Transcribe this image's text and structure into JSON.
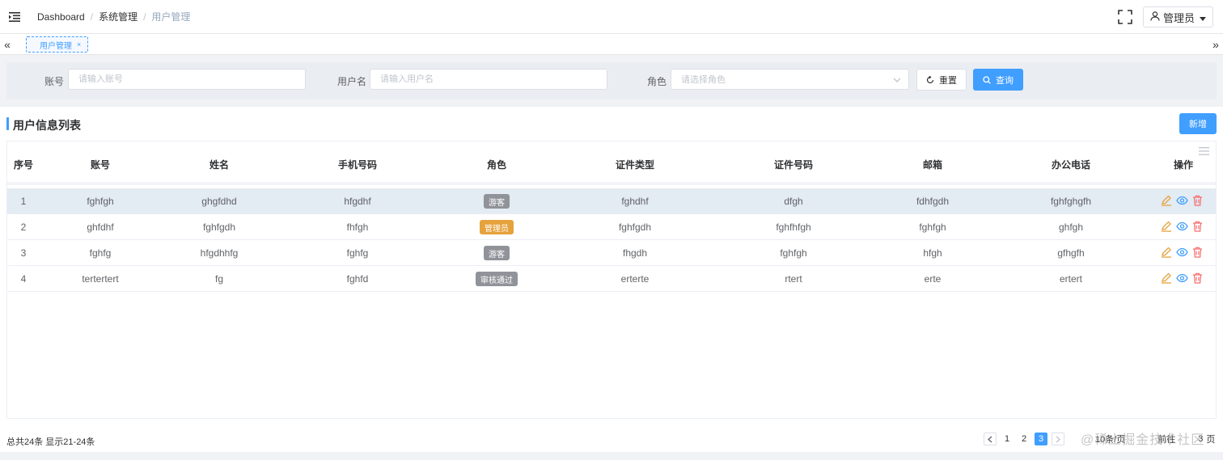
{
  "header": {
    "breadcrumbs": [
      "Dashboard",
      "系统管理",
      "用户管理"
    ],
    "user_name": "管理员"
  },
  "tags": [
    {
      "label": "用户管理",
      "close": "×"
    }
  ],
  "search": {
    "account_label": "账号",
    "account_placeholder": "请输入账号",
    "username_label": "用户名",
    "username_placeholder": "请输入用户名",
    "role_label": "角色",
    "role_placeholder": "请选择角色",
    "reset_label": "重置",
    "query_label": "查询"
  },
  "section": {
    "title": "用户信息列表",
    "add_label": "新增"
  },
  "table": {
    "columns": [
      "序号",
      "账号",
      "姓名",
      "手机号码",
      "角色",
      "证件类型",
      "证件号码",
      "邮箱",
      "办公电话",
      "操作"
    ],
    "rows": [
      {
        "index": "1",
        "account": "fghfgh",
        "name": "ghgfdhd",
        "phone": "hfgdhf",
        "role": "游客",
        "role_color": "#909399",
        "id_type": "fghdhf",
        "id_number": "dfgh",
        "email": "fdhfgdh",
        "office_phone": "fghfghgfh"
      },
      {
        "index": "2",
        "account": "ghfdhf",
        "name": "fghfgdh",
        "phone": "fhfgh",
        "role": "管理员",
        "role_color": "#e6a23c",
        "id_type": "fghfgdh",
        "id_number": "fghfhfgh",
        "email": "fghfgh",
        "office_phone": "ghfgh"
      },
      {
        "index": "3",
        "account": "fghfg",
        "name": "hfgdhhfg",
        "phone": "fghfg",
        "role": "游客",
        "role_color": "#909399",
        "id_type": "fhgdh",
        "id_number": "fghfgh",
        "email": "hfgh",
        "office_phone": "gfhgfh"
      },
      {
        "index": "4",
        "account": "tertertert",
        "name": "fg",
        "phone": "fghfd",
        "role": "审核通过",
        "role_color": "#909399",
        "id_type": "erterte",
        "id_number": "rtert",
        "email": "erte",
        "office_phone": "ertert"
      }
    ]
  },
  "footer": {
    "total_text": "总共24条 显示21-24条",
    "pages": [
      "1",
      "2",
      "3"
    ],
    "current_page": "3",
    "page_size": "10条/页",
    "goto_label": "前往",
    "jump_value": "3",
    "page_unit": "页"
  },
  "watermark": "@稀土掘金技术社区",
  "colors": {
    "primary": "#409eff",
    "edit": "#e6a23c",
    "view": "#409eff",
    "delete": "#f56c6c"
  }
}
